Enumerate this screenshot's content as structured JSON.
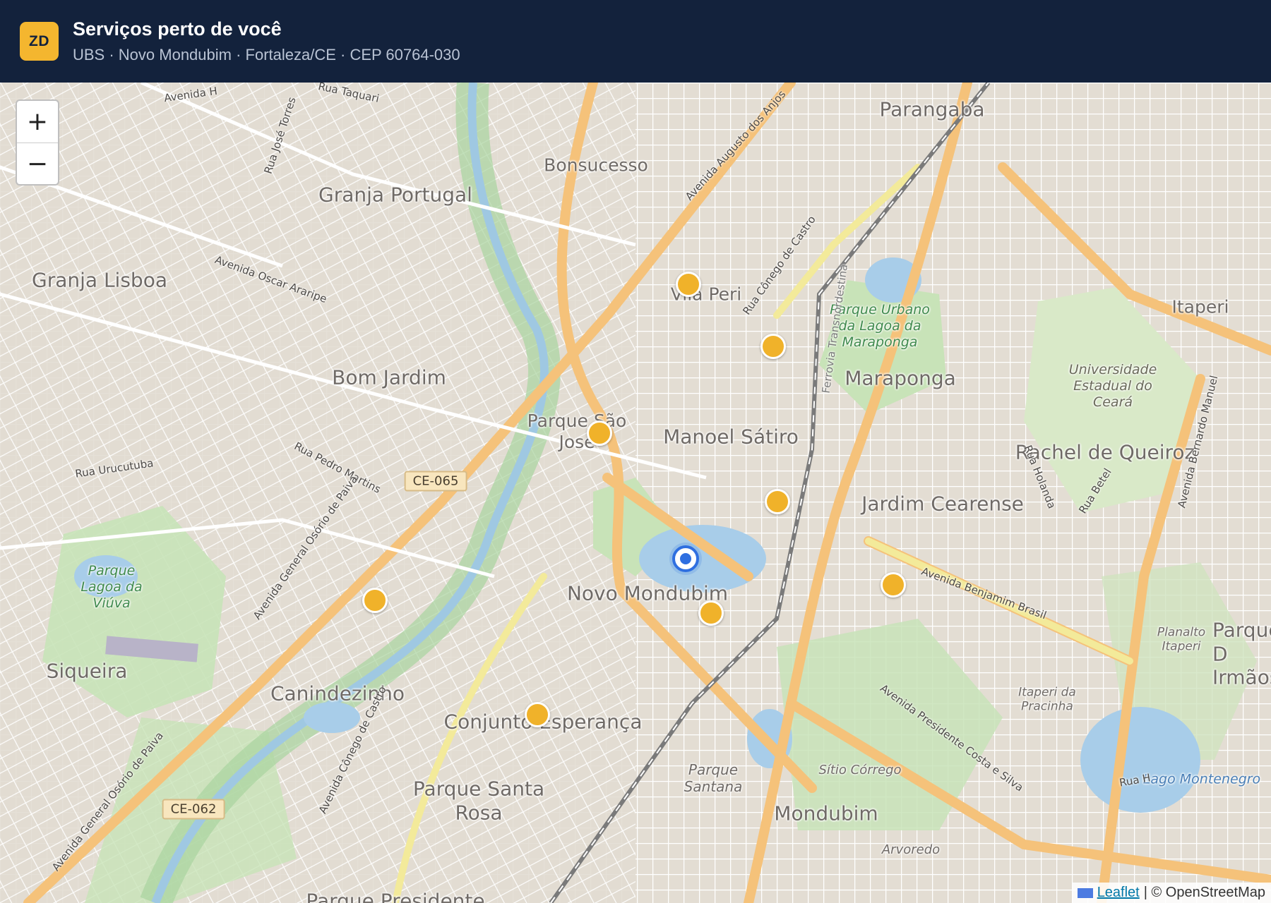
{
  "header": {
    "logo": "ZD",
    "title": "Serviços perto de você",
    "subtitle": "UBS · Novo Mondubim · Fortaleza/CE · CEP 60764-030"
  },
  "map": {
    "zoom_in": "+",
    "zoom_out": "−",
    "marker_color": "#f0b22a",
    "location_color": "#2f6fe0",
    "places": {
      "parangaba": "Parangaba",
      "bonsucesso": "Bonsucesso",
      "granja_portugal": "Granja Portugal",
      "granja_lisboa": "Granja Lisboa",
      "vila_peri": "Vila Peri",
      "itaperi": "Itaperi",
      "bom_jardim": "Bom Jardim",
      "maraponga": "Maraponga",
      "parque_sao_jose": "Parque São José",
      "manoel_satiro": "Manoel Sátiro",
      "rachel_de_queiroz": "Rachel de Queiroz",
      "jardim_cearense": "Jardim Cearense",
      "novo_mondubim": "Novo Mondubim",
      "siqueira": "Siqueira",
      "canindezinho": "Canindezinho",
      "conjunto_esperanca": "Conjunto Esperança",
      "parque_santa_rosa": "Parque Santa Rosa",
      "mondubim": "Mondubim",
      "parque_santana": "Parque Santana",
      "sitio_corrego": "Sítio Córrego",
      "arvoredo": "Arvoredo",
      "planalto_itaperi": "Planalto Itaperi",
      "itaperi_pracinha": "Itaperi da Pracinha",
      "parque_dois_irmaos": "Parque D Irmãos",
      "parque_lagoa_viuva": "Parque Lagoa da Viúva",
      "parque_maraponga": "Parque Urbano da Lagoa da Maraponga",
      "uece": "Universidade Estadual do Ceará",
      "lago_montenegro": "Lago Montenegro",
      "parque_presidente": "Parque Presidente"
    },
    "streets": {
      "av_h": "Avenida H",
      "rua_taquari": "Rua Taquari",
      "rua_jose_torres": "Rua José Torres",
      "av_augusto_anjos": "Avenida Augusto dos Anjos",
      "av_oscar_arraripe": "Avenida Oscar Araripe",
      "rua_conego_castro": "Rua Cônego de Castro",
      "ferrovia": "Ferrovia Transnordestina",
      "rua_urucutuba": "Rua Urucutuba",
      "rua_pedro_martins": "Rua Pedro Martins",
      "av_osorio_paiva": "Avenida General Osório de Paiva",
      "av_osorio_paiva_2": "Avenida General Osório de Paiva",
      "av_conego_castro": "Avenida Cônego de Castro",
      "av_benjamin_brasil": "Avenida Benjamim Brasil",
      "av_presidente_costa": "Avenida Presidente Costa e Silva",
      "rua_holanda": "Rua Holanda",
      "rua_betel": "Rua Betel",
      "av_bernardo_manuel": "Avenida Bernardo Manuel",
      "rua_h": "Rua H"
    },
    "shields": {
      "ce065": "CE-065",
      "ce062": "CE-062"
    },
    "attribution": {
      "leaflet": "Leaflet",
      "osm": "| © OpenStreetMap"
    }
  }
}
